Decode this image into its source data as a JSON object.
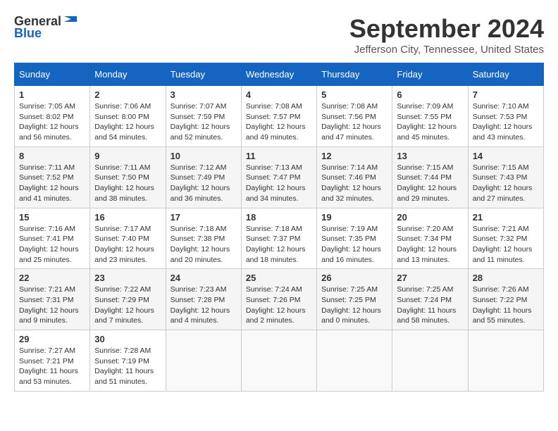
{
  "header": {
    "logo_general": "General",
    "logo_blue": "Blue",
    "month_title": "September 2024",
    "location": "Jefferson City, Tennessee, United States"
  },
  "columns": [
    "Sunday",
    "Monday",
    "Tuesday",
    "Wednesday",
    "Thursday",
    "Friday",
    "Saturday"
  ],
  "weeks": [
    [
      {
        "day": "1",
        "sunrise": "7:05 AM",
        "sunset": "8:02 PM",
        "daylight": "12 hours and 56 minutes."
      },
      {
        "day": "2",
        "sunrise": "7:06 AM",
        "sunset": "8:00 PM",
        "daylight": "12 hours and 54 minutes."
      },
      {
        "day": "3",
        "sunrise": "7:07 AM",
        "sunset": "7:59 PM",
        "daylight": "12 hours and 52 minutes."
      },
      {
        "day": "4",
        "sunrise": "7:08 AM",
        "sunset": "7:57 PM",
        "daylight": "12 hours and 49 minutes."
      },
      {
        "day": "5",
        "sunrise": "7:08 AM",
        "sunset": "7:56 PM",
        "daylight": "12 hours and 47 minutes."
      },
      {
        "day": "6",
        "sunrise": "7:09 AM",
        "sunset": "7:55 PM",
        "daylight": "12 hours and 45 minutes."
      },
      {
        "day": "7",
        "sunrise": "7:10 AM",
        "sunset": "7:53 PM",
        "daylight": "12 hours and 43 minutes."
      }
    ],
    [
      {
        "day": "8",
        "sunrise": "7:11 AM",
        "sunset": "7:52 PM",
        "daylight": "12 hours and 41 minutes."
      },
      {
        "day": "9",
        "sunrise": "7:11 AM",
        "sunset": "7:50 PM",
        "daylight": "12 hours and 38 minutes."
      },
      {
        "day": "10",
        "sunrise": "7:12 AM",
        "sunset": "7:49 PM",
        "daylight": "12 hours and 36 minutes."
      },
      {
        "day": "11",
        "sunrise": "7:13 AM",
        "sunset": "7:47 PM",
        "daylight": "12 hours and 34 minutes."
      },
      {
        "day": "12",
        "sunrise": "7:14 AM",
        "sunset": "7:46 PM",
        "daylight": "12 hours and 32 minutes."
      },
      {
        "day": "13",
        "sunrise": "7:15 AM",
        "sunset": "7:44 PM",
        "daylight": "12 hours and 29 minutes."
      },
      {
        "day": "14",
        "sunrise": "7:15 AM",
        "sunset": "7:43 PM",
        "daylight": "12 hours and 27 minutes."
      }
    ],
    [
      {
        "day": "15",
        "sunrise": "7:16 AM",
        "sunset": "7:41 PM",
        "daylight": "12 hours and 25 minutes."
      },
      {
        "day": "16",
        "sunrise": "7:17 AM",
        "sunset": "7:40 PM",
        "daylight": "12 hours and 23 minutes."
      },
      {
        "day": "17",
        "sunrise": "7:18 AM",
        "sunset": "7:38 PM",
        "daylight": "12 hours and 20 minutes."
      },
      {
        "day": "18",
        "sunrise": "7:18 AM",
        "sunset": "7:37 PM",
        "daylight": "12 hours and 18 minutes."
      },
      {
        "day": "19",
        "sunrise": "7:19 AM",
        "sunset": "7:35 PM",
        "daylight": "12 hours and 16 minutes."
      },
      {
        "day": "20",
        "sunrise": "7:20 AM",
        "sunset": "7:34 PM",
        "daylight": "12 hours and 13 minutes."
      },
      {
        "day": "21",
        "sunrise": "7:21 AM",
        "sunset": "7:32 PM",
        "daylight": "12 hours and 11 minutes."
      }
    ],
    [
      {
        "day": "22",
        "sunrise": "7:21 AM",
        "sunset": "7:31 PM",
        "daylight": "12 hours and 9 minutes."
      },
      {
        "day": "23",
        "sunrise": "7:22 AM",
        "sunset": "7:29 PM",
        "daylight": "12 hours and 7 minutes."
      },
      {
        "day": "24",
        "sunrise": "7:23 AM",
        "sunset": "7:28 PM",
        "daylight": "12 hours and 4 minutes."
      },
      {
        "day": "25",
        "sunrise": "7:24 AM",
        "sunset": "7:26 PM",
        "daylight": "12 hours and 2 minutes."
      },
      {
        "day": "26",
        "sunrise": "7:25 AM",
        "sunset": "7:25 PM",
        "daylight": "12 hours and 0 minutes."
      },
      {
        "day": "27",
        "sunrise": "7:25 AM",
        "sunset": "7:24 PM",
        "daylight": "11 hours and 58 minutes."
      },
      {
        "day": "28",
        "sunrise": "7:26 AM",
        "sunset": "7:22 PM",
        "daylight": "11 hours and 55 minutes."
      }
    ],
    [
      {
        "day": "29",
        "sunrise": "7:27 AM",
        "sunset": "7:21 PM",
        "daylight": "11 hours and 53 minutes."
      },
      {
        "day": "30",
        "sunrise": "7:28 AM",
        "sunset": "7:19 PM",
        "daylight": "11 hours and 51 minutes."
      },
      null,
      null,
      null,
      null,
      null
    ]
  ],
  "labels": {
    "sunrise": "Sunrise:",
    "sunset": "Sunset:",
    "daylight": "Daylight:"
  }
}
